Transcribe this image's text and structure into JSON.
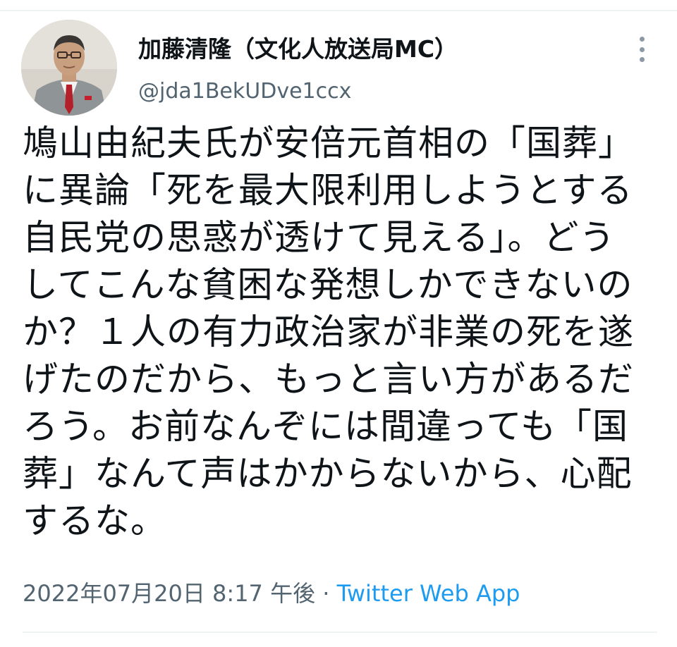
{
  "tweet": {
    "author": {
      "display_name": "加藤清隆（文化人放送局MC）",
      "handle": "@jda1BekUDve1ccx"
    },
    "body_lines": [
      "鳩山由紀夫氏が安倍元首相の「国葬」",
      "に異論「死を最大限利用しようとする",
      "自民党の思惑が透けて見える」。どう",
      "してこんな貧困な発想しかできないの",
      "か？１人の有力政治家が非業の死を遂",
      "げたのだから、もっと言い方があるだ",
      "ろう。お前なんぞには間違っても「国",
      "葬」なんて声はかからないから、心配",
      "するな。"
    ],
    "meta": {
      "timestamp": "2022年07月20日 8:17 午後",
      "separator": " · ",
      "source": "Twitter Web App"
    },
    "icons": {
      "avatar": "profile-photo",
      "more": "more-vertical-icon"
    },
    "colors": {
      "text": "#0f1419",
      "secondary": "#536471",
      "link": "#1d9bf0"
    }
  }
}
